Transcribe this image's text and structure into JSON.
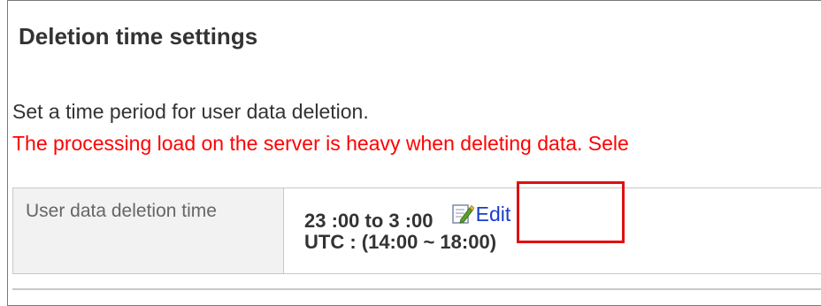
{
  "section": {
    "title": "Deletion time settings",
    "description": "Set a time period for user data deletion.",
    "warning": "The processing load on the server is heavy when deleting data. Sele"
  },
  "setting": {
    "label": "User data deletion time",
    "time_range": "23 :00  to  3 :00",
    "utc_range": "UTC : (14:00 ~ 18:00)",
    "edit_label": "Edit",
    "edit_icon": "edit-icon"
  },
  "colors": {
    "warning_text": "#ff0000",
    "link": "#1a3ccc",
    "highlight": "#e01010",
    "label_bg": "#f2f2f2"
  }
}
